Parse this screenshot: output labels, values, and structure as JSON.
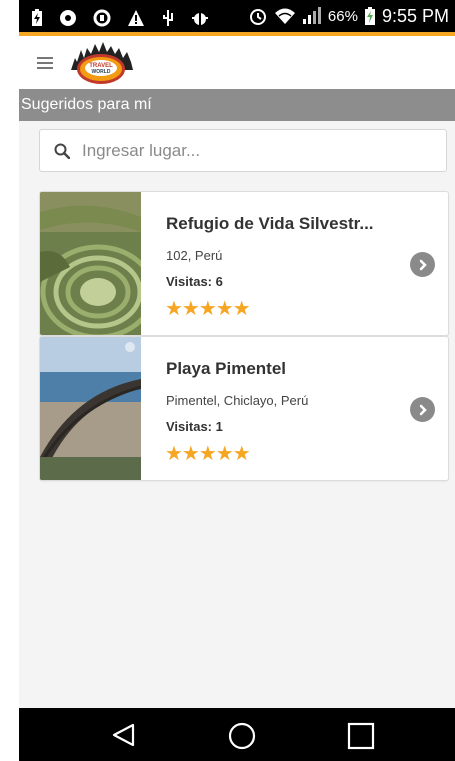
{
  "status_bar": {
    "battery_percent": "66%",
    "time": "9:55 PM",
    "icons": [
      "battery-charging-icon",
      "location-icon",
      "sync-icon",
      "warning-icon",
      "usb-icon",
      "android-debug-icon",
      "alarm-icon",
      "wifi-icon",
      "signal-icon",
      "battery-icon"
    ],
    "accent_color": "#f5a623"
  },
  "header": {
    "menu_icon": "hamburger-icon",
    "logo_text": "TRAVEL WORLD"
  },
  "section": {
    "title": "Sugeridos para mí"
  },
  "search": {
    "placeholder": "Ingresar lugar...",
    "value": ""
  },
  "places": [
    {
      "title": "Refugio de Vida Silvestr...",
      "location": "102, Perú",
      "visits": "Visitas: 6",
      "rating": 5,
      "stars": "★★★★★"
    },
    {
      "title": "Playa Pimentel",
      "location": "Pimentel, Chiclayo, Perú",
      "visits": "Visitas: 1",
      "rating": 5,
      "stars": "★★★★★"
    }
  ],
  "nav": {
    "buttons": [
      "back-icon",
      "home-icon",
      "recents-icon"
    ]
  }
}
